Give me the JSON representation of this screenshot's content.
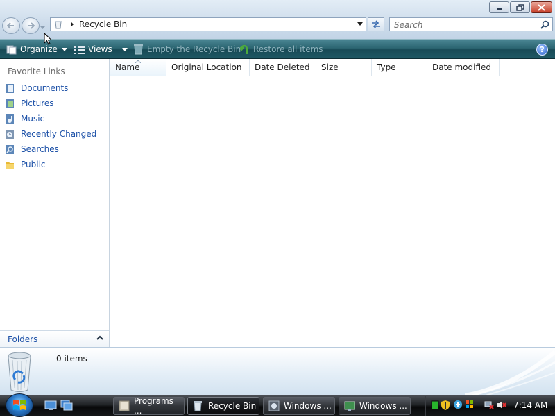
{
  "address": {
    "location": "Recycle Bin"
  },
  "search": {
    "placeholder": "Search"
  },
  "toolbar": {
    "organize": "Organize",
    "views": "Views",
    "empty": "Empty the Recycle Bin",
    "restore": "Restore all items",
    "help": "?"
  },
  "nav": {
    "favorites_header": "Favorite Links",
    "items": [
      {
        "label": "Documents",
        "icon": "documents-icon"
      },
      {
        "label": "Pictures",
        "icon": "pictures-icon"
      },
      {
        "label": "Music",
        "icon": "music-icon"
      },
      {
        "label": "Recently Changed",
        "icon": "recently-changed-icon"
      },
      {
        "label": "Searches",
        "icon": "searches-icon"
      },
      {
        "label": "Public",
        "icon": "public-folder-icon"
      }
    ],
    "folders_label": "Folders"
  },
  "columns": [
    "Name",
    "Original Location",
    "Date Deleted",
    "Size",
    "Type",
    "Date modified"
  ],
  "details": {
    "count": "0 items"
  },
  "taskbar": {
    "tasks": [
      "Programs ...",
      "Recycle Bin",
      "Windows ...",
      "Windows ..."
    ],
    "clock": "7:14 AM"
  },
  "colors": {
    "command_bar": "#2c6672",
    "link": "#1e52a8",
    "taskbar": "#1f2225"
  }
}
